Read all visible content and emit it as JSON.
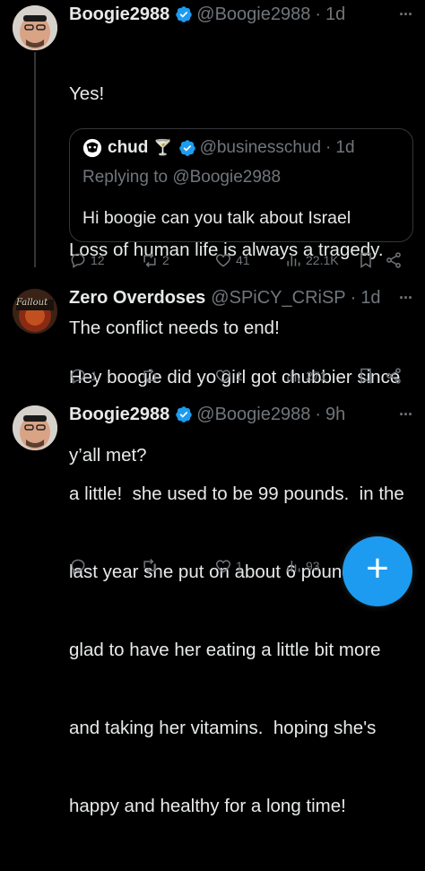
{
  "colors": {
    "background": "#000000",
    "text": "#e7e9ea",
    "muted": "#71767b",
    "accent": "#1d9bf0",
    "border": "#333639"
  },
  "tweets": [
    {
      "name": "Boogie2988",
      "handle": "@Boogie2988",
      "time": "1d",
      "lines": [
        "Yes!",
        "",
        "Loss of human life is always a tragedy.",
        "The conflict needs to end!"
      ],
      "quote": {
        "name": "chud",
        "emoji": "🍸",
        "handle": "@businesschud",
        "time": "1d",
        "reply_to": "Replying to @Boogie2988",
        "text": "Hi boogie can you talk about Israel"
      },
      "stats": {
        "replies": "12",
        "retweets": "2",
        "likes": "41",
        "views": "22.1K"
      }
    },
    {
      "name": "Zero Overdoses",
      "handle": "@SPiCY_CRiSP",
      "time": "1d",
      "avatar_text": "Fallout",
      "lines": [
        "Hey boogie did yo girl got chubbier since",
        "y’all met?"
      ],
      "stats": {
        "replies": "1",
        "retweets": "",
        "likes": "1",
        "views": "271"
      }
    },
    {
      "name": "Boogie2988",
      "handle": "@Boogie2988",
      "time": "9h",
      "lines": [
        "a little!  she used to be 99 pounds.  in the",
        "last year she put on about 6 pounds!  I'm",
        "glad to have her eating a little bit more",
        "and taking her vitamins.  hoping she's",
        "happy and healthy for a long time!"
      ],
      "stats": {
        "replies": "",
        "retweets": "",
        "likes": "1",
        "views": "93"
      }
    }
  ],
  "compose_button": {
    "label": "+"
  }
}
